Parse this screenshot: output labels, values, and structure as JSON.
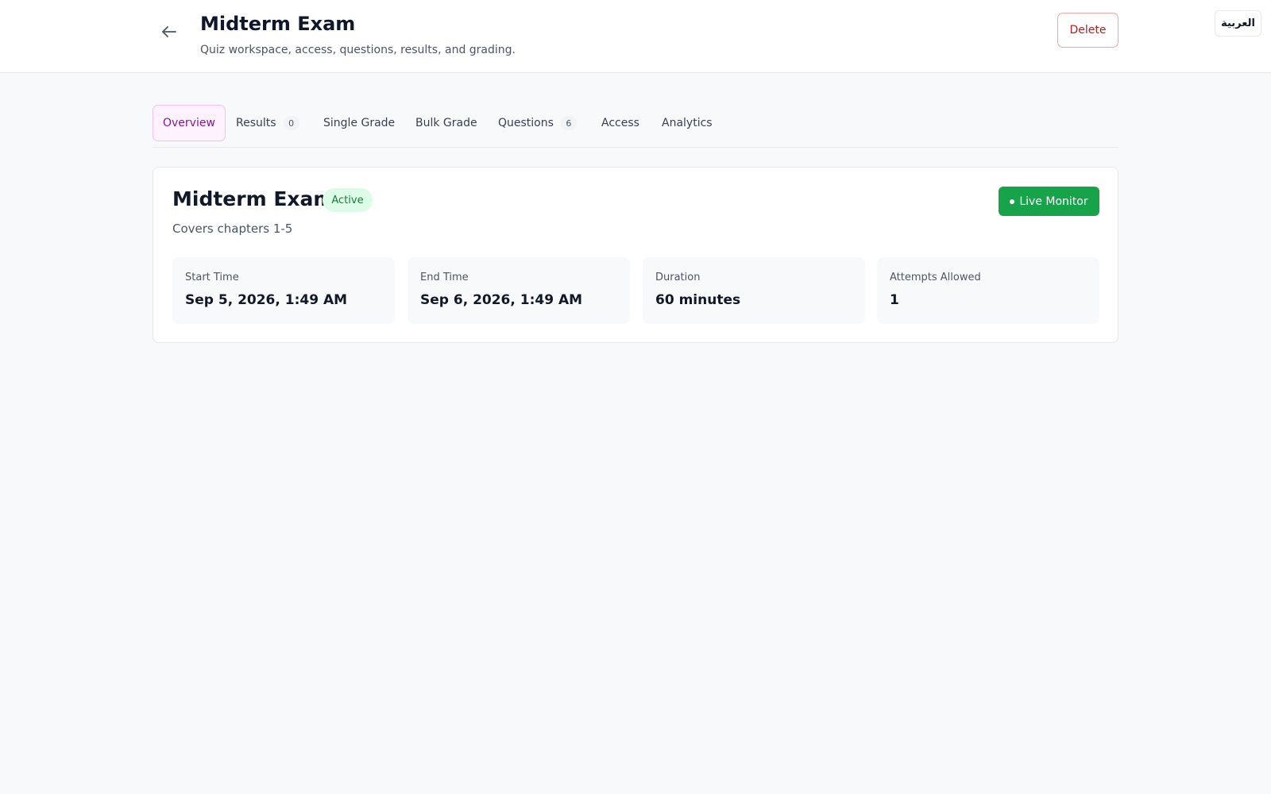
{
  "header": {
    "title": "Midterm Exam",
    "subtitle": "Quiz workspace, access, questions, results, and grading.",
    "back_icon": "arrow-left-icon",
    "delete_label": "Delete",
    "language_label": "العربية"
  },
  "tabs": [
    {
      "label": "Overview",
      "active": true
    },
    {
      "label": "Results",
      "count": "0"
    },
    {
      "label": "Single Grade"
    },
    {
      "label": "Bulk Grade"
    },
    {
      "label": "Questions",
      "count": "6"
    },
    {
      "label": "Access"
    },
    {
      "label": "Analytics"
    }
  ],
  "quiz": {
    "title": "Midterm Exam",
    "status": "Active",
    "description": "Covers chapters 1-5",
    "live_monitor_label": "Live Monitor",
    "stats": [
      {
        "label": "Start Time",
        "value": "Sep 5, 2026, 1:49 AM"
      },
      {
        "label": "End Time",
        "value": "Sep 6, 2026, 1:49 AM"
      },
      {
        "label": "Duration",
        "value": "60 minutes"
      },
      {
        "label": "Attempts Allowed",
        "value": "1"
      }
    ]
  },
  "colors": {
    "accent": "#86198f",
    "danger": "#b91c1c",
    "success": "#16a34a",
    "status_bg": "#dcfce7"
  }
}
